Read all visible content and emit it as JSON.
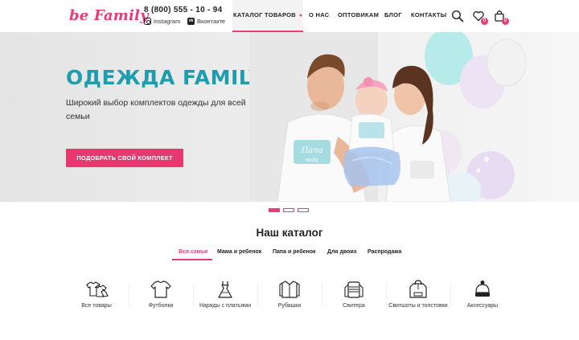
{
  "header": {
    "logo_text": "be Family",
    "phone": "8 (800) 555 - 10 - 94",
    "social": [
      {
        "label": "Instagram",
        "icon": "instagram-icon"
      },
      {
        "label": "Вконтакте",
        "icon": "vk-icon"
      }
    ],
    "nav": [
      {
        "label": "КАТАЛОГ ТОВАРОВ",
        "active": true
      },
      {
        "label": "О НАС"
      },
      {
        "label": "ОПТОВИКАМ"
      },
      {
        "label": "БЛОГ"
      },
      {
        "label": "КОНТАКТЫ"
      }
    ],
    "wishlist_count": "0",
    "cart_count": "0"
  },
  "hero": {
    "title": "ОДЕЖДА FAMILY LOOK",
    "subtitle": "Широкий выбор комплектов одежды для всей семьи",
    "button_label": "ПОДОБРАТЬ СВОЙ КОМПЛЕКТ",
    "slides_total": 3,
    "slide_active": 1
  },
  "catalog": {
    "title": "Наш каталог",
    "tabs": [
      {
        "label": "Вся семья",
        "active": true
      },
      {
        "label": "Мама и ребенок"
      },
      {
        "label": "Папа и ребенок"
      },
      {
        "label": "Для двоих"
      },
      {
        "label": "Распродажа"
      }
    ],
    "categories": [
      {
        "label": "Все товары",
        "icon": "all-products-icon"
      },
      {
        "label": "Футболки",
        "icon": "tshirt-icon"
      },
      {
        "label": "Наряды с платьями",
        "icon": "dress-icon"
      },
      {
        "label": "Рубашки",
        "icon": "shirt-icon"
      },
      {
        "label": "Свитера",
        "icon": "sweater-icon"
      },
      {
        "label": "Свитшоты и толстовки",
        "icon": "hoodie-icon"
      },
      {
        "label": "Аксессуары",
        "icon": "hat-icon"
      }
    ]
  },
  "colors": {
    "brand_pink": "#e83b7a",
    "hero_title_teal": "#1f9cad"
  }
}
